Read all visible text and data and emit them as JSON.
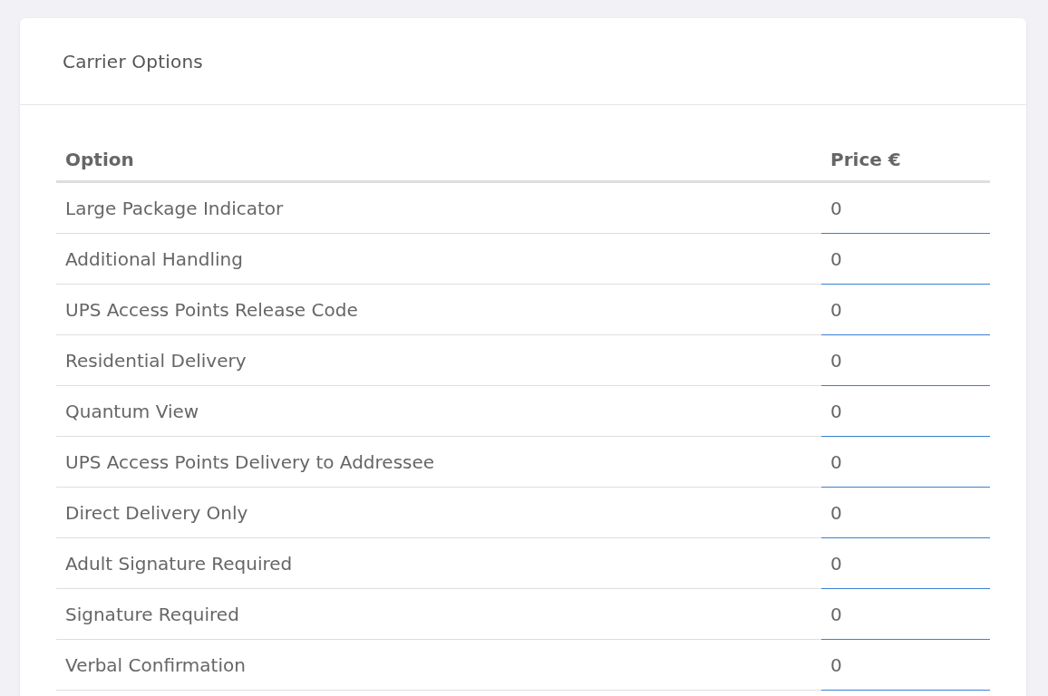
{
  "card": {
    "title": "Carrier Options"
  },
  "table": {
    "columns": [
      "Option",
      "Price €"
    ],
    "rows": [
      {
        "option": "Large Package Indicator",
        "price": "0"
      },
      {
        "option": "Additional Handling",
        "price": "0"
      },
      {
        "option": "UPS Access Points Release Code",
        "price": "0"
      },
      {
        "option": "Residential Delivery",
        "price": "0"
      },
      {
        "option": "Quantum View",
        "price": "0"
      },
      {
        "option": "UPS Access Points Delivery to Addressee",
        "price": "0"
      },
      {
        "option": "Direct Delivery Only",
        "price": "0"
      },
      {
        "option": "Adult Signature Required",
        "price": "0"
      },
      {
        "option": "Signature Required",
        "price": "0"
      },
      {
        "option": "Verbal Confirmation",
        "price": "0"
      }
    ]
  }
}
